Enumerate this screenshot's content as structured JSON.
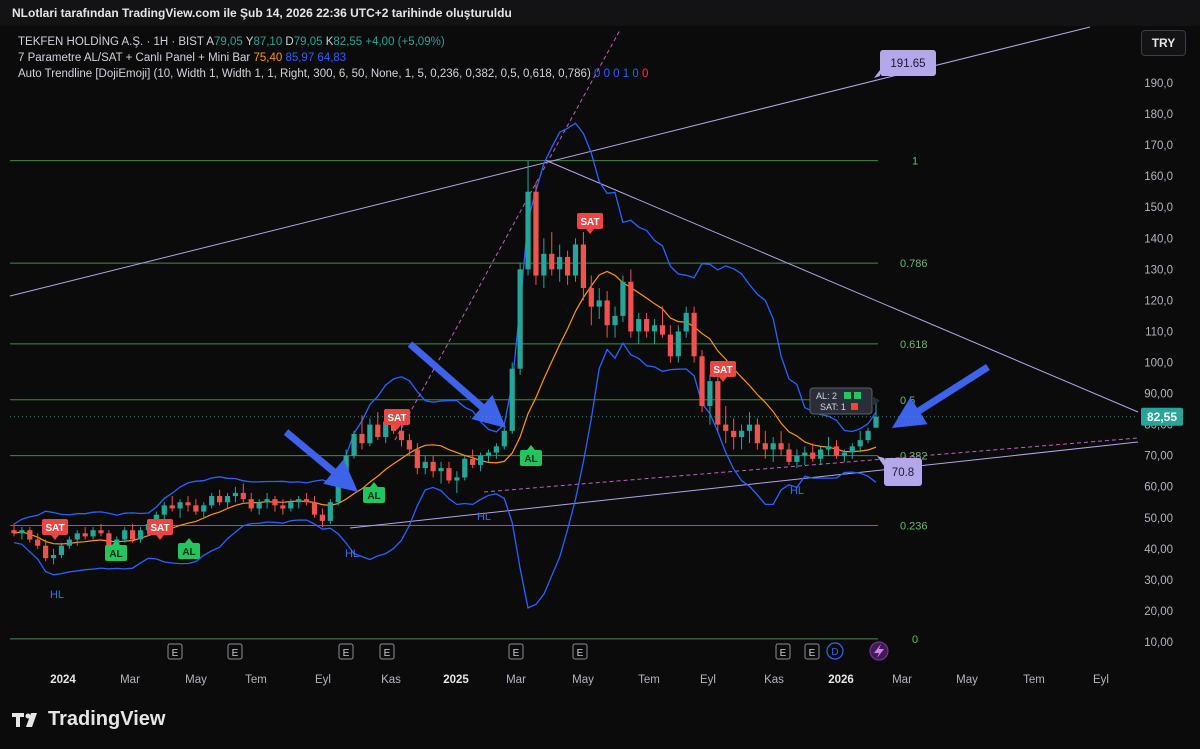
{
  "header": {
    "title": "NLotlari tarafından TradingView.com ile Şub 14, 2026 22:36 UTC+2 tarihinde oluşturuldu"
  },
  "legend": {
    "symbol": "TEKFEN HOLDİNG A.Ş. · 1H · BIST",
    "a_label": "A",
    "a_value": "79,05",
    "y_label": "Y",
    "y_value": "87,10",
    "d_label": "D",
    "d_value": "79,05",
    "k_label": "K",
    "k_value": "82,55",
    "change": "+4,00 (+5,09%)",
    "ind1_name": "7 Parametre AL/SAT + Canlı Panel + Mini Bar",
    "ind1_v1": "75,40",
    "ind1_v2": "85,97",
    "ind1_v3": "64,83",
    "ind2_name": "Auto Trendline [DojiEmoji] (10, Width 1, Width 1, 1, Right, 300, 6, 50, None, 1, 5, 0,236, 0,382, 0,5, 0,618, 0,786)",
    "ind2_vals": "0 0 0 1 0",
    "ind2_last": "0"
  },
  "currency_button": "TRY",
  "logo_text": "TradingView",
  "colors": {
    "up": "#26a69a",
    "down": "#ef5350",
    "ma": "#ff9800",
    "band": "#2962ff",
    "fib": "#4caf50",
    "trend": "#b3a6e6",
    "al": "#22c55e",
    "sat": "#ef4444"
  },
  "chart_data": {
    "type": "candlestick",
    "y_axis": {
      "ticks": [
        "10,00",
        "20,00",
        "30,00",
        "40,00",
        "50,00",
        "60,00",
        "70,00",
        "80,00",
        "90,00",
        "100,0",
        "110,0",
        "120,0",
        "130,0",
        "140,0",
        "150,0",
        "160,0",
        "170,0",
        "180,0",
        "190,0"
      ],
      "range": [
        10,
        190
      ]
    },
    "x_axis": {
      "ticks": [
        "2024",
        "Mar",
        "May",
        "Tem",
        "Eyl",
        "Kas",
        "2025",
        "Mar",
        "May",
        "Tem",
        "Eyl",
        "Kas",
        "2026",
        "Mar",
        "May",
        "Tem",
        "Eyl"
      ]
    },
    "last_price": "82,55",
    "fib_levels": [
      {
        "label": "1",
        "price": 165
      },
      {
        "label": "0.786",
        "price": 132
      },
      {
        "label": "0.618",
        "price": 106
      },
      {
        "label": "0.5",
        "price": 88
      },
      {
        "label": "0.382",
        "price": 70
      },
      {
        "label": "0.236",
        "price": 47.5
      },
      {
        "label": "0",
        "price": 11
      }
    ],
    "trend_labels": {
      "upper": "191.65",
      "lower": "70.8"
    },
    "signals": [
      {
        "type": "SAT",
        "label": "SAT"
      },
      {
        "type": "AL",
        "label": "AL"
      },
      {
        "type": "SAT",
        "label": "SAT"
      },
      {
        "type": "AL",
        "label": "AL"
      },
      {
        "type": "AL",
        "label": "AL"
      },
      {
        "type": "SAT",
        "label": "SAT"
      },
      {
        "type": "AL",
        "label": "AL"
      },
      {
        "type": "SAT",
        "label": "SAT"
      },
      {
        "type": "SAT",
        "label": "SAT"
      }
    ],
    "hl_label": "HL",
    "event_marker": "E",
    "dividend_marker": "D",
    "panel": {
      "al": "AL: 2",
      "sat": "SAT: 1"
    },
    "candles": [
      [
        46,
        48,
        44,
        45
      ],
      [
        45,
        47,
        43,
        46
      ],
      [
        46,
        47,
        42,
        43
      ],
      [
        43,
        45,
        40,
        41
      ],
      [
        41,
        43,
        36,
        37
      ],
      [
        37,
        40,
        35,
        38
      ],
      [
        38,
        42,
        37,
        41
      ],
      [
        41,
        44,
        40,
        43
      ],
      [
        43,
        46,
        41,
        45
      ],
      [
        45,
        47,
        43,
        44
      ],
      [
        44,
        47,
        43,
        46
      ],
      [
        46,
        48,
        44,
        45
      ],
      [
        45,
        46,
        40,
        41
      ],
      [
        41,
        44,
        40,
        43
      ],
      [
        43,
        47,
        42,
        46
      ],
      [
        46,
        48,
        42,
        43
      ],
      [
        43,
        47,
        42,
        46
      ],
      [
        46,
        49,
        44,
        48
      ],
      [
        48,
        52,
        46,
        51
      ],
      [
        51,
        55,
        49,
        54
      ],
      [
        54,
        57,
        52,
        53
      ],
      [
        53,
        56,
        50,
        55
      ],
      [
        55,
        57,
        52,
        54
      ],
      [
        54,
        56,
        51,
        52
      ],
      [
        52,
        55,
        50,
        54
      ],
      [
        54,
        58,
        53,
        57
      ],
      [
        57,
        59,
        54,
        55
      ],
      [
        55,
        58,
        53,
        57
      ],
      [
        57,
        60,
        55,
        58
      ],
      [
        58,
        61,
        55,
        56
      ],
      [
        56,
        58,
        52,
        53
      ],
      [
        53,
        56,
        51,
        55
      ],
      [
        55,
        58,
        53,
        56
      ],
      [
        56,
        57,
        52,
        54
      ],
      [
        54,
        56,
        51,
        53
      ],
      [
        53,
        56,
        52,
        55
      ],
      [
        55,
        57,
        53,
        56
      ],
      [
        56,
        58,
        54,
        55
      ],
      [
        55,
        57,
        50,
        51
      ],
      [
        51,
        53,
        47,
        49
      ],
      [
        49,
        56,
        48,
        55
      ],
      [
        55,
        64,
        54,
        63
      ],
      [
        63,
        72,
        62,
        70
      ],
      [
        70,
        78,
        69,
        77
      ],
      [
        77,
        83,
        72,
        74
      ],
      [
        74,
        82,
        73,
        80
      ],
      [
        80,
        84,
        75,
        76
      ],
      [
        76,
        82,
        74,
        81
      ],
      [
        81,
        83,
        77,
        78
      ],
      [
        78,
        80,
        73,
        75
      ],
      [
        75,
        77,
        70,
        72
      ],
      [
        72,
        74,
        64,
        66
      ],
      [
        66,
        70,
        64,
        68
      ],
      [
        68,
        70,
        63,
        65
      ],
      [
        65,
        68,
        61,
        66
      ],
      [
        66,
        68,
        61,
        62
      ],
      [
        62,
        65,
        58,
        63
      ],
      [
        63,
        70,
        62,
        69
      ],
      [
        69,
        72,
        66,
        67
      ],
      [
        67,
        71,
        65,
        70
      ],
      [
        70,
        72,
        68,
        71
      ],
      [
        71,
        74,
        69,
        73
      ],
      [
        73,
        79,
        72,
        78
      ],
      [
        78,
        100,
        77,
        98
      ],
      [
        98,
        132,
        96,
        130
      ],
      [
        130,
        165,
        128,
        155
      ],
      [
        155,
        158,
        125,
        128
      ],
      [
        128,
        140,
        124,
        135
      ],
      [
        135,
        142,
        128,
        130
      ],
      [
        130,
        138,
        126,
        134
      ],
      [
        134,
        136,
        125,
        128
      ],
      [
        128,
        140,
        126,
        138
      ],
      [
        138,
        142,
        120,
        124
      ],
      [
        124,
        128,
        112,
        118
      ],
      [
        118,
        124,
        114,
        120
      ],
      [
        120,
        123,
        108,
        112
      ],
      [
        112,
        118,
        108,
        115
      ],
      [
        115,
        128,
        113,
        126
      ],
      [
        126,
        130,
        108,
        110
      ],
      [
        110,
        116,
        106,
        114
      ],
      [
        114,
        116,
        108,
        110
      ],
      [
        110,
        114,
        106,
        112
      ],
      [
        112,
        118,
        108,
        109
      ],
      [
        109,
        112,
        100,
        102
      ],
      [
        102,
        112,
        100,
        110
      ],
      [
        110,
        118,
        108,
        116
      ],
      [
        116,
        118,
        100,
        102
      ],
      [
        102,
        104,
        84,
        86
      ],
      [
        86,
        96,
        80,
        94
      ],
      [
        94,
        98,
        78,
        80
      ],
      [
        80,
        86,
        74,
        78
      ],
      [
        78,
        82,
        72,
        76
      ],
      [
        76,
        80,
        72,
        78
      ],
      [
        78,
        84,
        74,
        80
      ],
      [
        80,
        82,
        72,
        74
      ],
      [
        74,
        78,
        69,
        72
      ],
      [
        72,
        76,
        68,
        74
      ],
      [
        74,
        78,
        70,
        72
      ],
      [
        72,
        74,
        67,
        68
      ],
      [
        68,
        72,
        66,
        70
      ],
      [
        70,
        73,
        67,
        71
      ],
      [
        71,
        74,
        68,
        69
      ],
      [
        69,
        73,
        67,
        72
      ],
      [
        72,
        76,
        70,
        73
      ],
      [
        73,
        75,
        69,
        70
      ],
      [
        70,
        72,
        68,
        71
      ],
      [
        71,
        74,
        69,
        73
      ],
      [
        73,
        78,
        71,
        75
      ],
      [
        75,
        79,
        74,
        78
      ],
      [
        79,
        87,
        79,
        82.55
      ]
    ]
  }
}
